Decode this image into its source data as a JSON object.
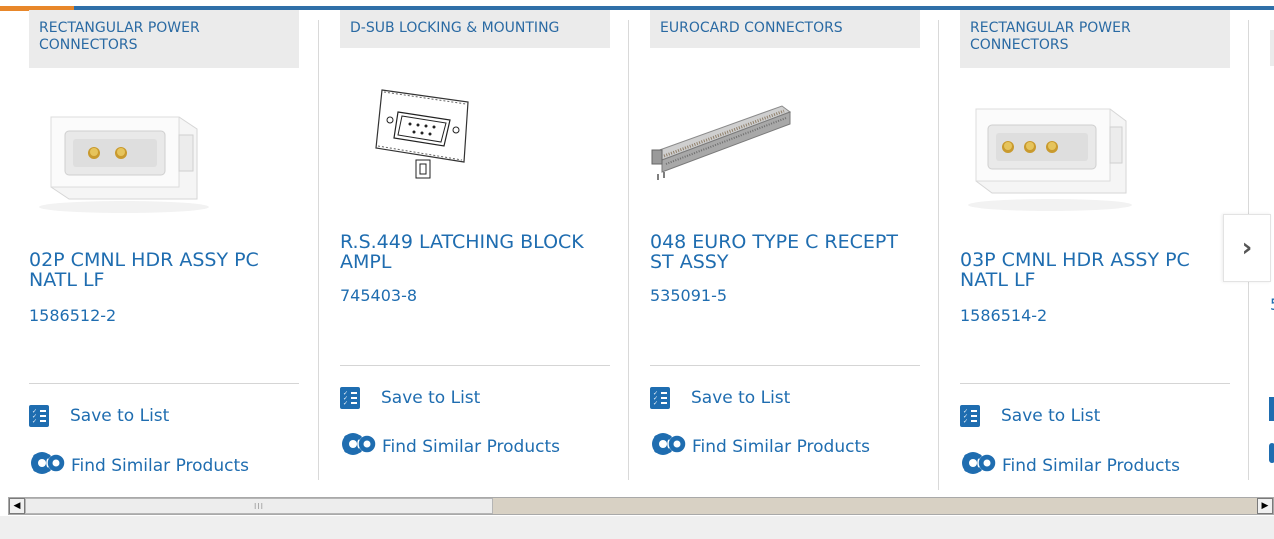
{
  "products": [
    {
      "category": "RECTANGULAR POWER CONNECTORS",
      "title": "02P CMNL HDR ASSY PC NATL LF",
      "part_number": "1586512-2",
      "image": "2-pin-white-header"
    },
    {
      "category": "D-SUB LOCKING & MOUNTING",
      "title": "R.S.449 LATCHING BLOCK AMPL",
      "part_number": "745403-8",
      "image": "dsub-line-drawing"
    },
    {
      "category": "EUROCARD CONNECTORS",
      "title": "048 EURO TYPE C RECEPT ST ASSY",
      "part_number": "535091-5",
      "image": "eurocard-strip"
    },
    {
      "category": "RECTANGULAR POWER CONNECTORS",
      "title": "03P CMNL HDR ASSY PC NATL LF",
      "part_number": "1586514-2",
      "image": "3-pin-white-header"
    }
  ],
  "actions": {
    "save_label": "Save to List",
    "similar_label": "Find Similar Products"
  },
  "partial_card": {
    "part_number_fragment": "5"
  },
  "icons": {
    "save": "checklist-icon",
    "similar": "gears-icon",
    "next": "chevron-right-icon"
  },
  "next_glyph": "›",
  "scrollbar": {
    "left_glyph": "◀",
    "right_glyph": "▶",
    "grip": "III"
  },
  "colors": {
    "link": "#1f6db0",
    "category_bg": "#ebebeb",
    "accent_orange": "#e8872a",
    "accent_blue": "#2f6fa8"
  }
}
